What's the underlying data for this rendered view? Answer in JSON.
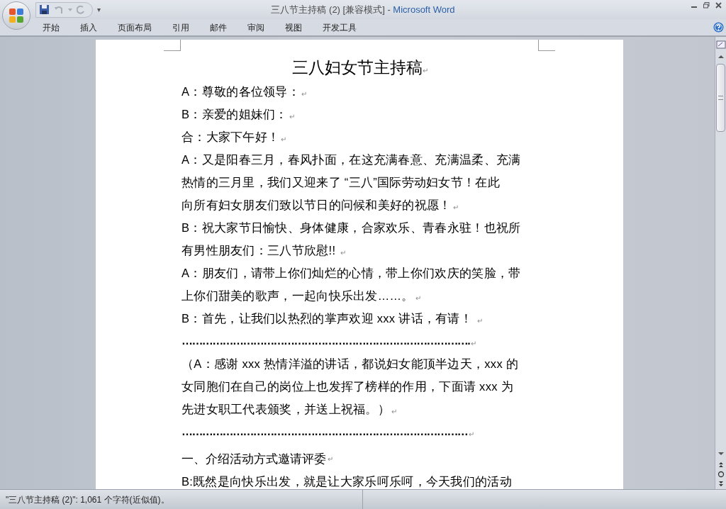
{
  "window": {
    "title_doc": "三八节主持稿 (2) [兼容模式]",
    "title_sep": " - ",
    "title_app": "Microsoft Word",
    "quick_access_more": "▾"
  },
  "tabs": [
    {
      "label": "开始",
      "selected": false
    },
    {
      "label": "插入",
      "selected": false
    },
    {
      "label": "页面布局",
      "selected": false
    },
    {
      "label": "引用",
      "selected": false
    },
    {
      "label": "邮件",
      "selected": false
    },
    {
      "label": "审阅",
      "selected": false
    },
    {
      "label": "视图",
      "selected": false
    },
    {
      "label": "开发工具",
      "selected": false
    }
  ],
  "document": {
    "title": "三八妇女节主持稿",
    "title_mark": "↵",
    "paragraphs": [
      {
        "kind": "text",
        "lines": [
          "A：尊敬的各位领导："
        ],
        "end_mark": "↵"
      },
      {
        "kind": "text",
        "lines": [
          "B：亲爱的姐妹们："
        ],
        "end_mark": "↵"
      },
      {
        "kind": "text",
        "lines": [
          "合：大家下午好！"
        ],
        "end_mark": "↵"
      },
      {
        "kind": "text",
        "lines": [
          "A：又是阳春三月，春风扑面，在这充满春意、充满温柔、充满",
          "热情的三月里，我们又迎来了 “三八”国际劳动妇女节！在此",
          "向所有妇女朋友们致以节日的问候和美好的祝愿！"
        ],
        "end_mark": "↵"
      },
      {
        "kind": "text",
        "lines": [
          "B：祝大家节日愉快、身体健康，合家欢乐、青春永驻！也祝所",
          "有男性朋友们：三八节欣慰!! "
        ],
        "end_mark": "↵"
      },
      {
        "kind": "text",
        "lines": [
          "A：朋友们，请带上你们灿烂的心情，带上你们欢庆的笑脸，带",
          "上你们甜美的歌声，一起向快乐出发……。"
        ],
        "end_mark": "↵"
      },
      {
        "kind": "text",
        "lines": [
          "B：首先，让我们以热烈的掌声欢迎 xxx 讲话，有请！ "
        ],
        "end_mark": "↵"
      },
      {
        "kind": "dots",
        "lines": [
          "…………………………………………………………………………."
        ],
        "end_mark": "↵"
      },
      {
        "kind": "text",
        "lines": [
          "（A：感谢 xxx 热情洋溢的讲话，都说妇女能顶半边天，xxx 的",
          "女同胞们在自己的岗位上也发挥了榜样的作用，下面请 xxx 为",
          "先进女职工代表颁奖，并送上祝福。）"
        ],
        "end_mark": "↵"
      },
      {
        "kind": "dots",
        "lines": [
          "…………………………………………………………………………"
        ],
        "end_mark": "↵"
      },
      {
        "kind": "heading",
        "lines": [
          "一、介绍活动方式邀请评委"
        ],
        "end_mark": "↵"
      },
      {
        "kind": "text",
        "lines": [
          "B:既然是向快乐出发，就是让大家乐呵乐呵，今天我们的活动"
        ]
      }
    ]
  },
  "status_bar": {
    "text": "\"三八节主持稿 (2)\": 1,061 个字符(近似值)。"
  }
}
